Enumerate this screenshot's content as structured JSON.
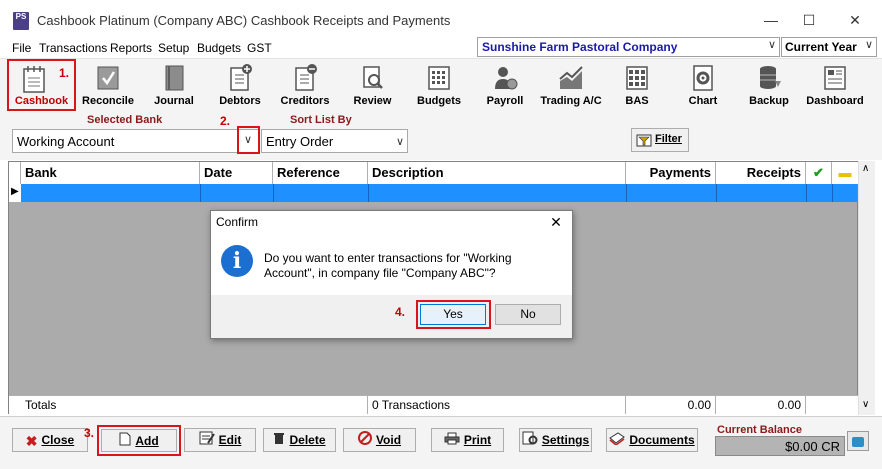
{
  "window": {
    "logo_text": "PS",
    "title": "Cashbook Platinum (Company ABC)  Cashbook Receipts and Payments",
    "minimize_glyph": "—",
    "maximize_glyph": "☐",
    "close_glyph": "✕"
  },
  "menu": {
    "items": [
      "File",
      "Transactions",
      "Reports",
      "Setup",
      "Budgets",
      "GST"
    ],
    "company": "Sunshine Farm Pastoral Company",
    "year": "Current Year"
  },
  "toolbar": {
    "items": [
      {
        "label": "Cashbook",
        "icon": "notepad-icon"
      },
      {
        "label": "Reconcile",
        "icon": "checkbox-icon"
      },
      {
        "label": "Journal",
        "icon": "book-icon"
      },
      {
        "label": "Debtors",
        "icon": "ledger-plus-icon"
      },
      {
        "label": "Creditors",
        "icon": "ledger-minus-icon"
      },
      {
        "label": "Review",
        "icon": "magnifier-icon"
      },
      {
        "label": "Budgets",
        "icon": "calculator-icon"
      },
      {
        "label": "Payroll",
        "icon": "person-money-icon"
      },
      {
        "label": "Trading A/C",
        "icon": "line-chart-icon"
      },
      {
        "label": "BAS",
        "icon": "grid-form-icon"
      },
      {
        "label": "Chart",
        "icon": "gear-sheet-icon"
      },
      {
        "label": "Backup",
        "icon": "database-icon"
      },
      {
        "label": "Dashboard",
        "icon": "dashboard-icon"
      }
    ]
  },
  "steps": {
    "step1": "1.",
    "step2": "2.",
    "step3": "3.",
    "step4": "4."
  },
  "filters": {
    "selected_bank_label": "Selected Bank",
    "selected_bank_value": "Working Account",
    "sort_label": "Sort List By",
    "sort_value": "Entry Order",
    "filter_button": "Filter"
  },
  "grid": {
    "columns": [
      "Bank",
      "Date",
      "Reference",
      "Description",
      "Payments",
      "Receipts"
    ],
    "tick_glyph": "✔",
    "folder_glyph": "▬"
  },
  "totals": {
    "label": "Totals",
    "transactions": "0 Transactions",
    "payments": "0.00",
    "receipts": "0.00"
  },
  "buttons": {
    "close": "Close",
    "add": "Add",
    "edit": "Edit",
    "delete": "Delete",
    "void": "Void",
    "print": "Print",
    "settings": "Settings",
    "documents": "Documents"
  },
  "balance": {
    "label": "Current Balance",
    "value": "$0.00 CR"
  },
  "dialog": {
    "title": "Confirm",
    "icon_glyph": "i",
    "message": "Do you want to enter transactions for \"Working Account\", in company file \"Company ABC\"?",
    "yes": "Yes",
    "no": "No",
    "close_glyph": "✕"
  },
  "colors": {
    "highlight_red": "#d9141a",
    "step_red": "#c00000",
    "selected_row_blue": "#1e90ff",
    "company_text_blue": "#1a1aa8",
    "dialog_icon_blue": "#1a6fd0"
  }
}
